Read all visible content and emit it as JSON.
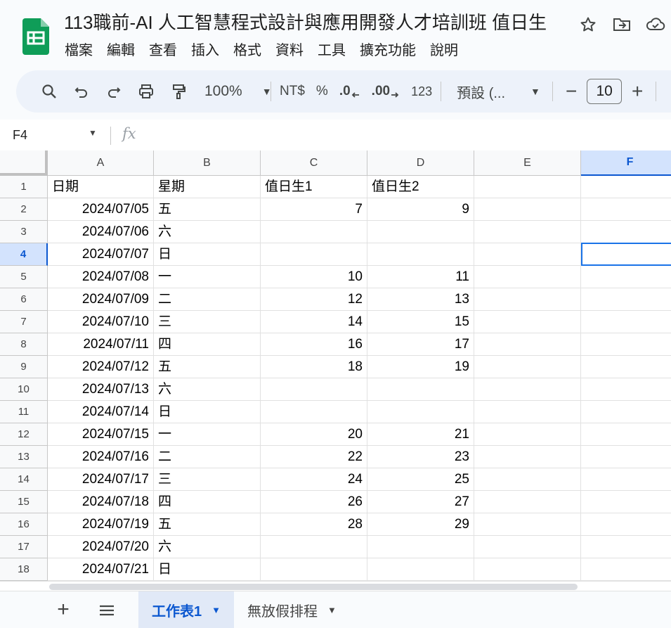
{
  "document": {
    "title": "113職前-AI 人工智慧程式設計與應用開發人才培訓班 值日生"
  },
  "menu": [
    "檔案",
    "編輯",
    "查看",
    "插入",
    "格式",
    "資料",
    "工具",
    "擴充功能",
    "說明"
  ],
  "toolbar": {
    "zoom": "100%",
    "currency": "NT$",
    "percent": "%",
    "decrease_decimal": ".0",
    "increase_decimal": ".00",
    "number_format": "123",
    "font": "預設 (...",
    "font_size": "10",
    "minus": "−",
    "plus": "+"
  },
  "formula_bar": {
    "name_box": "F4",
    "fx": "fx"
  },
  "grid": {
    "columns": [
      "A",
      "B",
      "C",
      "D",
      "E",
      "F"
    ],
    "selected_column": "F",
    "selected_row": 4,
    "rows": [
      {
        "n": "1",
        "a": "日期",
        "b": "星期",
        "c": "值日生1",
        "d": "值日生2"
      },
      {
        "n": "2",
        "a": "2024/07/05",
        "b": "五",
        "c": "7",
        "d": "9"
      },
      {
        "n": "3",
        "a": "2024/07/06",
        "b": "六",
        "c": "",
        "d": ""
      },
      {
        "n": "4",
        "a": "2024/07/07",
        "b": "日",
        "c": "",
        "d": ""
      },
      {
        "n": "5",
        "a": "2024/07/08",
        "b": "一",
        "c": "10",
        "d": "11"
      },
      {
        "n": "6",
        "a": "2024/07/09",
        "b": "二",
        "c": "12",
        "d": "13"
      },
      {
        "n": "7",
        "a": "2024/07/10",
        "b": "三",
        "c": "14",
        "d": "15"
      },
      {
        "n": "8",
        "a": "2024/07/11",
        "b": "四",
        "c": "16",
        "d": "17"
      },
      {
        "n": "9",
        "a": "2024/07/12",
        "b": "五",
        "c": "18",
        "d": "19"
      },
      {
        "n": "10",
        "a": "2024/07/13",
        "b": "六",
        "c": "",
        "d": ""
      },
      {
        "n": "11",
        "a": "2024/07/14",
        "b": "日",
        "c": "",
        "d": ""
      },
      {
        "n": "12",
        "a": "2024/07/15",
        "b": "一",
        "c": "20",
        "d": "21"
      },
      {
        "n": "13",
        "a": "2024/07/16",
        "b": "二",
        "c": "22",
        "d": "23"
      },
      {
        "n": "14",
        "a": "2024/07/17",
        "b": "三",
        "c": "24",
        "d": "25"
      },
      {
        "n": "15",
        "a": "2024/07/18",
        "b": "四",
        "c": "26",
        "d": "27"
      },
      {
        "n": "16",
        "a": "2024/07/19",
        "b": "五",
        "c": "28",
        "d": "29"
      },
      {
        "n": "17",
        "a": "2024/07/20",
        "b": "六",
        "c": "",
        "d": ""
      },
      {
        "n": "18",
        "a": "2024/07/21",
        "b": "日",
        "c": "",
        "d": ""
      }
    ]
  },
  "sheets": {
    "add": "+",
    "tabs": [
      {
        "label": "工作表1",
        "active": true
      },
      {
        "label": "無放假排程",
        "active": false
      }
    ]
  },
  "colors": {
    "accent": "#0b57d0",
    "selection_header": "#d3e3fd",
    "active_cell_border": "#1a73e8",
    "toolbar_bg": "#edf2fa",
    "sheets_logo": "#0f9d58"
  }
}
